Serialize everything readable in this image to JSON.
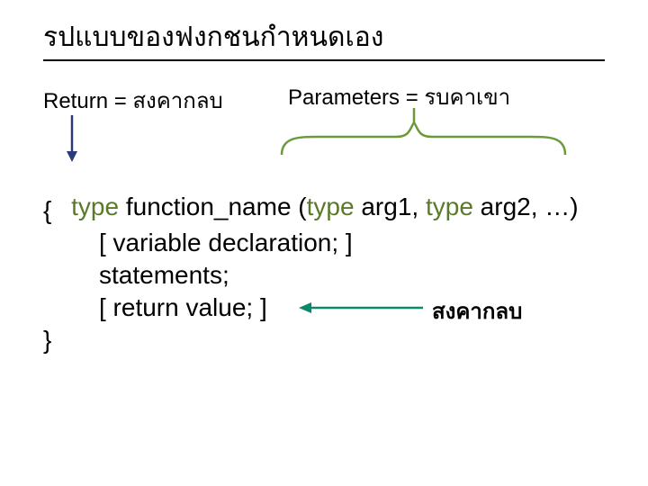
{
  "title": "รปแบบของฟงกชนกำหนดเอง",
  "labels": {
    "return": "Return = สงคากลบ",
    "parameters": "Parameters = รบคาเขา",
    "send_back": "สงคากลบ"
  },
  "code": {
    "type_kw": "type",
    "fn_part": " function_name (",
    "arg1": " arg1, ",
    "arg2": " arg2, …)",
    "open_brace": "{",
    "var_decl": "[ variable declaration; ]",
    "statements": "statements;",
    "return_line": "[ return value; ]",
    "close_brace": "}"
  },
  "colors": {
    "keyword": "#5a7a2a",
    "arrow_down": "#2a3a7a",
    "brace_arrow": "#6a9a3a",
    "text": "#000000"
  }
}
